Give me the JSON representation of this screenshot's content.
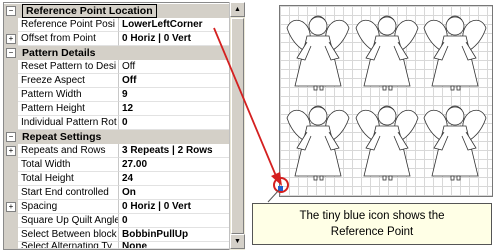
{
  "property_grid": {
    "sections": [
      {
        "title": "Reference Point Location",
        "rows": [
          {
            "name": "Reference Point Posi",
            "value": "LowerLeftCorner"
          },
          {
            "name": "Offset from Point",
            "value": "0 Horiz | 0 Vert"
          }
        ]
      },
      {
        "title": "Pattern Details",
        "rows": [
          {
            "name": "Reset Pattern to Desi",
            "value": "Off"
          },
          {
            "name": "Freeze Aspect",
            "value": "Off"
          },
          {
            "name": "Pattern Width",
            "value": "9"
          },
          {
            "name": "Pattern Height",
            "value": "12"
          },
          {
            "name": "Individual Pattern Rot",
            "value": "0"
          }
        ]
      },
      {
        "title": "Repeat Settings",
        "rows": [
          {
            "name": "Repeats and Rows",
            "value": "3 Repeats | 2 Rows"
          },
          {
            "name": "Total Width",
            "value": "27.00"
          },
          {
            "name": "Total Height",
            "value": "24"
          },
          {
            "name": "Start End controlled",
            "value": "On"
          },
          {
            "name": "Spacing",
            "value": "0 Horiz | 0 Vert"
          },
          {
            "name": "Square Up Quilt Angle",
            "value": "0"
          },
          {
            "name": "Select Between block",
            "value": "BobbinPullUp"
          },
          {
            "name": "Select Alternating Ty",
            "value": "None"
          }
        ]
      }
    ]
  },
  "callout": {
    "line1": "The tiny blue icon shows the",
    "line2": "Reference Point"
  },
  "colors": {
    "arrow": "#d42020",
    "marker": "#d42020",
    "reference_icon": "#1f5fd0"
  }
}
